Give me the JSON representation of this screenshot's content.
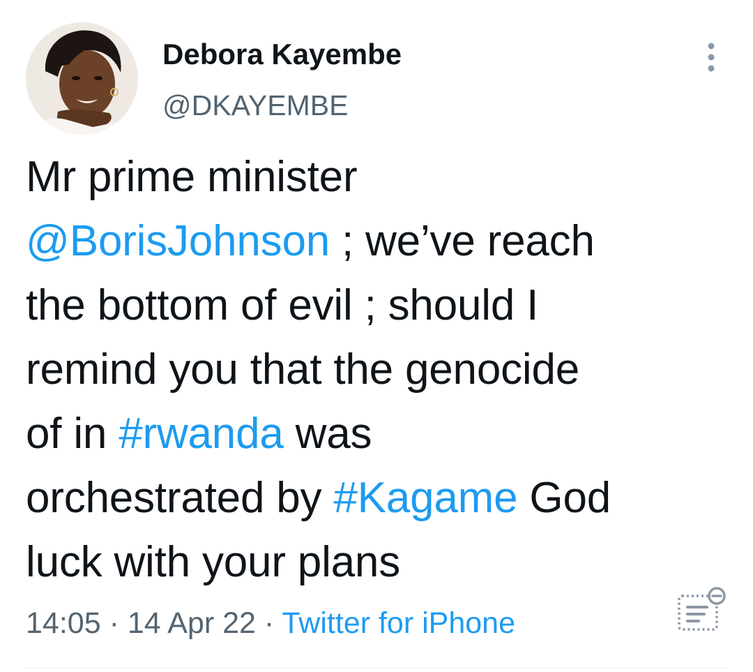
{
  "author": {
    "display_name": "Debora Kayembe",
    "handle": "@DKAYEMBE",
    "avatar_icon": "profile-photo"
  },
  "tweet": {
    "lines": [
      [
        {
          "text": "Mr prime minister",
          "type": "text"
        }
      ],
      [
        {
          "text": "@BorisJohnson",
          "type": "mention"
        },
        {
          "text": " ; we’ve reach",
          "type": "text"
        }
      ],
      [
        {
          "text": "the bottom of evil ; should I",
          "type": "text"
        }
      ],
      [
        {
          "text": "remind you that the genocide",
          "type": "text"
        }
      ],
      [
        {
          "text": "of in ",
          "type": "text"
        },
        {
          "text": "#rwanda",
          "type": "hashtag"
        },
        {
          "text": " was",
          "type": "text"
        }
      ],
      [
        {
          "text": "orchestrated by ",
          "type": "text"
        },
        {
          "text": "#Kagame",
          "type": "hashtag"
        },
        {
          "text": " God",
          "type": "text"
        }
      ],
      [
        {
          "text": "luck with your plans",
          "type": "text"
        }
      ]
    ]
  },
  "meta": {
    "time": "14:05",
    "separator": "·",
    "date": "14 Apr 22",
    "source": "Twitter for iPhone"
  },
  "icons": {
    "more": "more-vertical-icon",
    "analytics": "tweet-analytics-icon"
  },
  "colors": {
    "link": "#1d9bf0",
    "secondary": "#536471",
    "text": "#0f1419"
  }
}
